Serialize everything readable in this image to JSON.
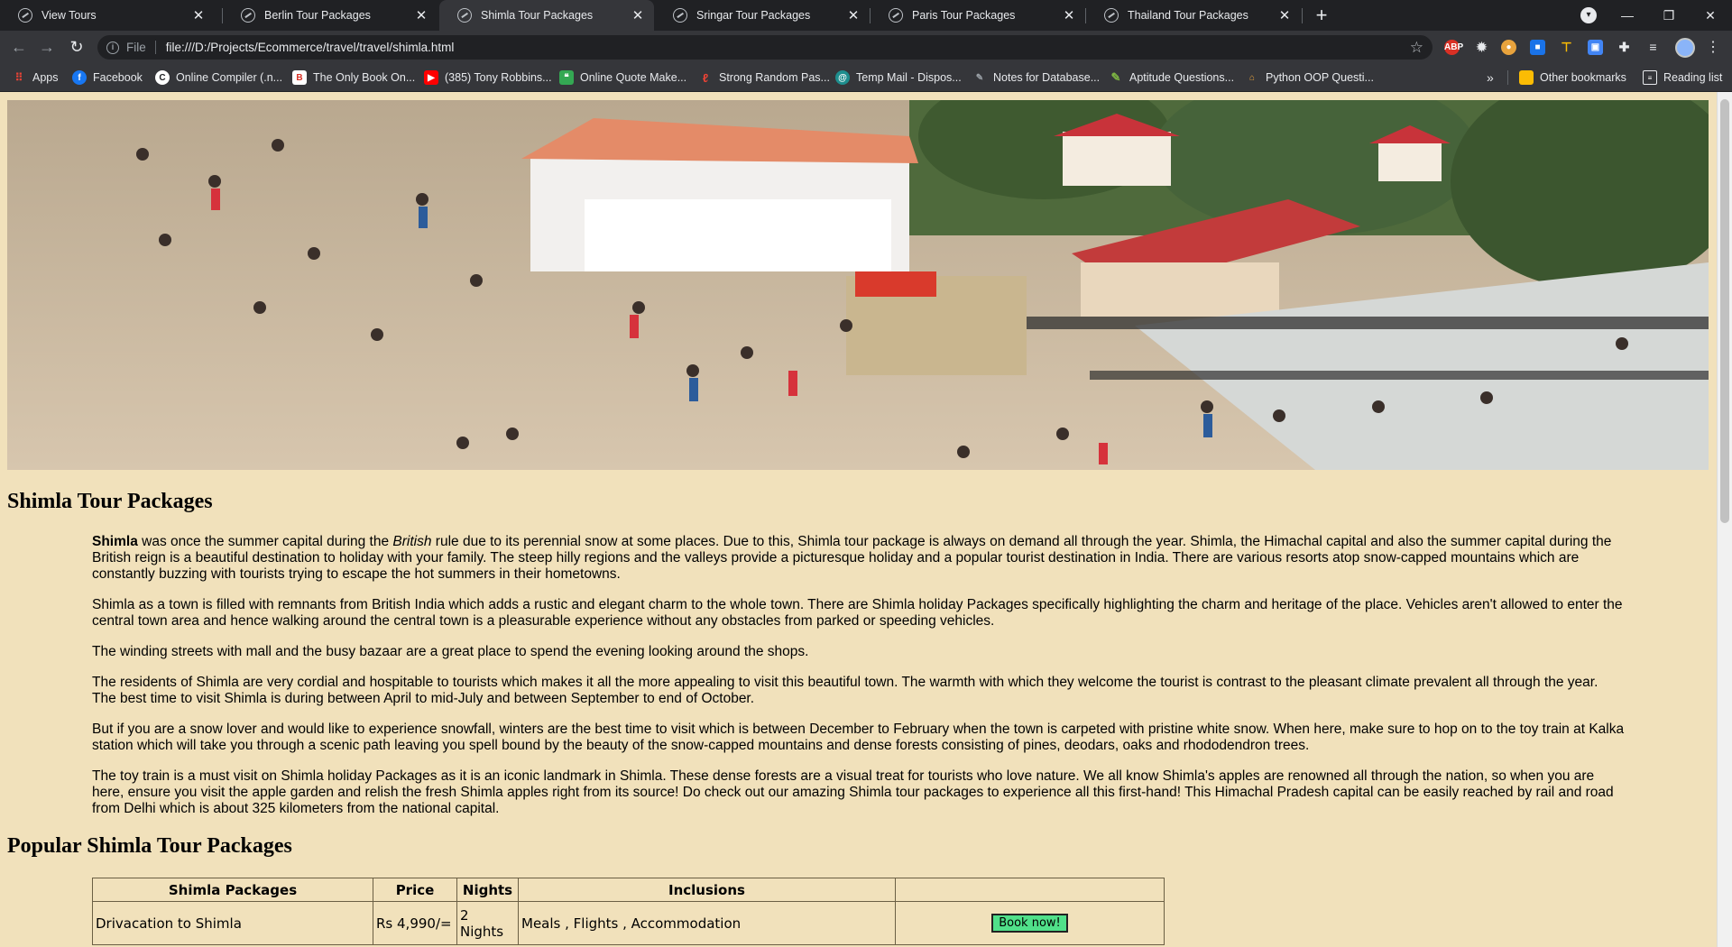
{
  "tabs": [
    {
      "title": "View Tours"
    },
    {
      "title": "Berlin Tour Packages"
    },
    {
      "title": "Shimla Tour Packages",
      "active": true
    },
    {
      "title": "Sringar Tour Packages"
    },
    {
      "title": "Paris Tour Packages"
    },
    {
      "title": "Thailand Tour Packages"
    }
  ],
  "toolbar": {
    "scheme": "File",
    "url": "file:///D:/Projects/Ecommerce/travel/travel/shimla.html"
  },
  "bookmarks": [
    {
      "label": "Apps",
      "icon": "apps-grid-icon"
    },
    {
      "label": "Facebook",
      "icon": "facebook-icon"
    },
    {
      "label": "Online Compiler (.n...",
      "icon": "compiler-icon"
    },
    {
      "label": "The Only Book On...",
      "icon": "book-icon"
    },
    {
      "label": "(385) Tony Robbins...",
      "icon": "youtube-icon"
    },
    {
      "label": "Online Quote Make...",
      "icon": "quote-icon"
    },
    {
      "label": "Strong Random Pas...",
      "icon": "password-icon"
    },
    {
      "label": "Temp Mail - Dispos...",
      "icon": "mail-icon"
    },
    {
      "label": "Notes for Database...",
      "icon": "notes-icon"
    },
    {
      "label": "Aptitude Questions...",
      "icon": "aptitude-icon"
    },
    {
      "label": "Python OOP Questi...",
      "icon": "python-icon"
    }
  ],
  "bookmarks_more": "»",
  "other_bookmarks": "Other bookmarks",
  "reading_list": "Reading list",
  "page": {
    "title": "Shimla Tour Packages",
    "intro_bold": "Shimla",
    "intro_a": " was once the summer capital during the ",
    "intro_italic": "British",
    "intro_b": " rule due to its perennial snow at some places. Due to this, Shimla tour package is always on demand all through the year. Shimla, the Himachal capital and also the summer capital during the British reign is a beautiful destination to holiday with your family. The steep hilly regions and the valleys provide a picturesque holiday and a popular tourist destination in India. There are various resorts atop snow-capped mountains which are constantly buzzing with tourists trying to escape the hot summers in their hometowns.",
    "paragraphs": [
      "Shimla as a town is filled with remnants from British India which adds a rustic and elegant charm to the whole town. There are Shimla holiday Packages specifically highlighting the charm and heritage of the place. Vehicles aren't allowed to enter the central town area and hence walking around the central town is a pleasurable experience without any obstacles from parked or speeding vehicles.",
      "The winding streets with mall and the busy bazaar are a great place to spend the evening looking around the shops.",
      "The residents of Shimla are very cordial and hospitable to tourists which makes it all the more appealing to visit this beautiful town. The warmth with which they welcome the tourist is contrast to the pleasant climate prevalent all through the year. The best time to visit Shimla is during between April to mid-July and between September to end of October.",
      "But if you are a snow lover and would like to experience snowfall, winters are the best time to visit which is between December to February when the town is carpeted with pristine white snow. When here, make sure to hop on to the toy train at Kalka station which will take you through a scenic path leaving you spell bound by the beauty of the snow-capped mountains and dense forests consisting of pines, deodars, oaks and rhododendron trees.",
      "The toy train is a must visit on Shimla holiday Packages as it is an iconic landmark in Shimla. These dense forests are a visual treat for tourists who love nature. We all know Shimla's apples are renowned all through the nation, so when you are here, ensure you visit the apple garden and relish the fresh Shimla apples right from its source! Do check out our amazing Shimla tour packages to experience all this first-hand! This Himachal Pradesh capital can be easily reached by rail and road from Delhi which is about 325 kilometers from the national capital."
    ],
    "popular_heading": "Popular Shimla Tour Packages",
    "table": {
      "headers": [
        "Shimla Packages",
        "Price",
        "Nights",
        "Inclusions",
        ""
      ],
      "rows": [
        {
          "name": "Drivacation to Shimla",
          "price": "Rs 4,990/=",
          "nights": "2 Nights",
          "inclusions": "Meals , Flights , Accommodation",
          "button": "Book now!"
        }
      ]
    }
  },
  "colors": {
    "page_bg": "#f1e1bb",
    "chrome_dark": "#202124",
    "chrome_toolbar": "#35363a",
    "book_button": "#50e089"
  }
}
